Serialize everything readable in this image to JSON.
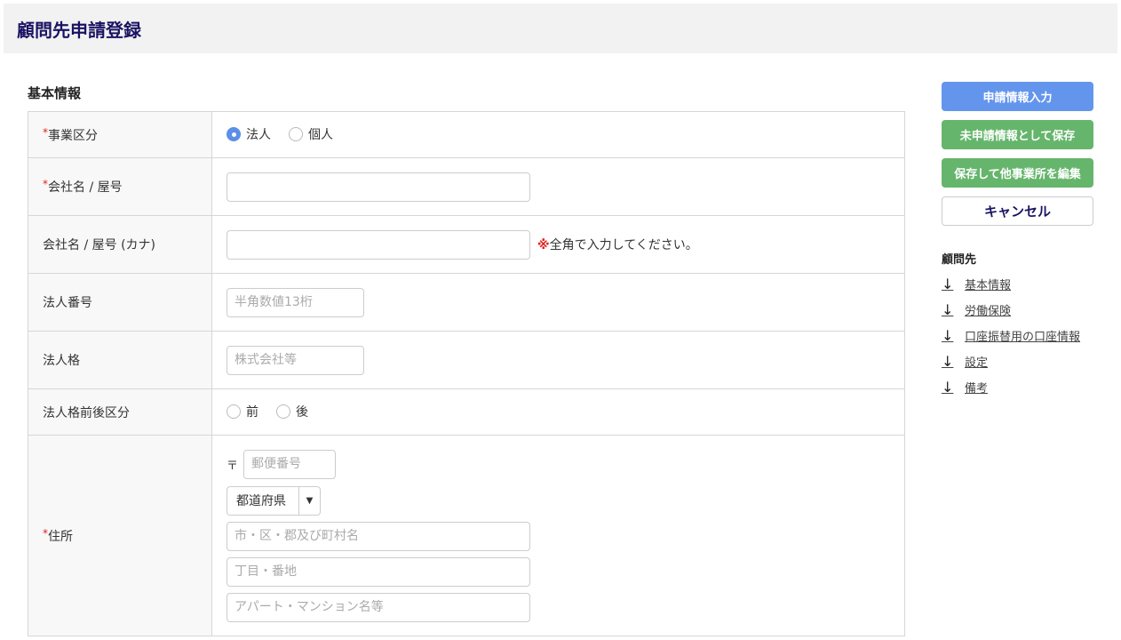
{
  "title": "顧問先申請登録",
  "section": "基本情報",
  "req": "*",
  "rows": {
    "jigyo": {
      "label": "事業区分",
      "opt1": "法人",
      "opt2": "個人"
    },
    "name": {
      "label": "会社名 / 屋号"
    },
    "kana": {
      "label": "会社名 / 屋号 (カナ)",
      "note_mark": "※",
      "note": "全角で入力してください。"
    },
    "number": {
      "label": "法人番号",
      "placeholder": "半角数値13桁"
    },
    "kaku": {
      "label": "法人格",
      "placeholder": "株式会社等"
    },
    "zengo": {
      "label": "法人格前後区分",
      "opt1": "前",
      "opt2": "後"
    },
    "addr": {
      "label": "住所",
      "postal_mark": "〒",
      "postal": "郵便番号",
      "pref": "都道府県",
      "city": "市・区・郡及び町村名",
      "street": "丁目・番地",
      "building": "アパート・マンション名等"
    }
  },
  "side": {
    "b1": "申請情報入力",
    "b2": "未申請情報として保存",
    "b3": "保存して他事業所を編集",
    "b4": "キャンセル",
    "nav_title": "顧問先",
    "nav": [
      "基本情報",
      "労働保険",
      "口座振替用の口座情報",
      "設定",
      "備考"
    ]
  }
}
